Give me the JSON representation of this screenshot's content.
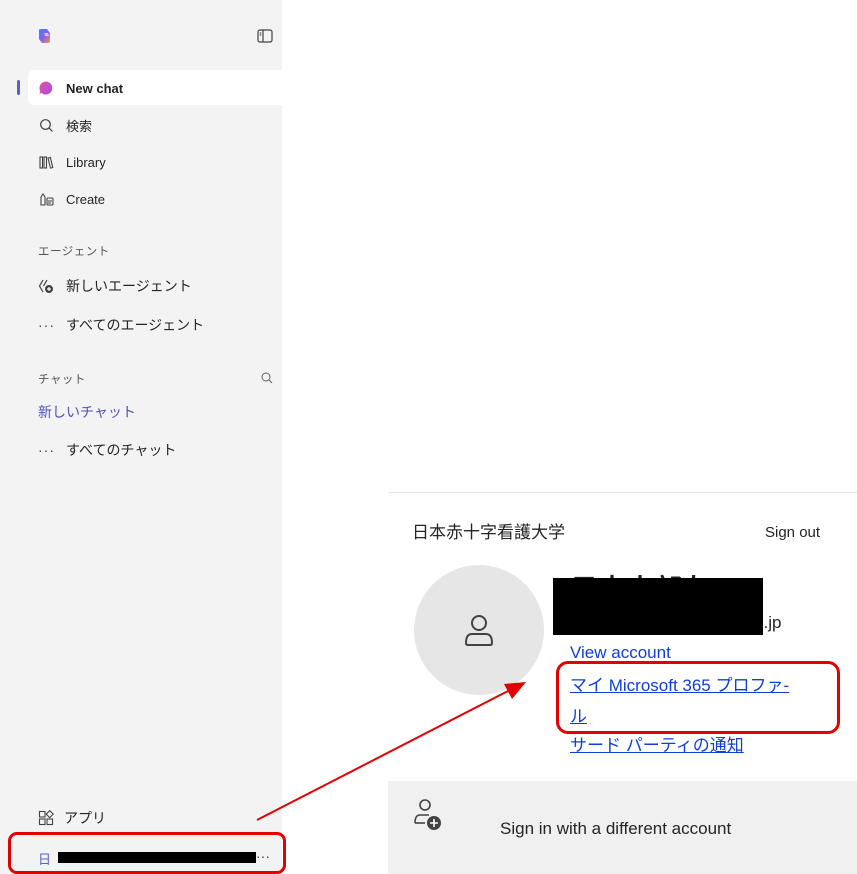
{
  "sidebar": {
    "new_chat": "New chat",
    "search": "検索",
    "library": "Library",
    "create": "Create",
    "agents_section": "エージェント",
    "new_agent": "新しいエージェント",
    "all_agents": "すべてのエージェント",
    "chats_section": "チャット",
    "recent_chat": "新しいチャット",
    "all_chats": "すべてのチャット",
    "apps": "アプリ",
    "account_initial": "日",
    "more": "···",
    "accent_color": "#5b5fc7"
  },
  "popup": {
    "organization": "日本赤十字看護大学",
    "sign_out": "Sign out",
    "user_name": "日本赤部丸",
    "email_suffix": "c.jp",
    "view_account": "View account",
    "m365_profile_line1": "マイ Microsoft 365 プロファ-",
    "m365_profile_line2": "ル",
    "third_party_notice": "サード パーティの通知",
    "sign_in_different": "Sign in with a different account",
    "link_color": "#0f3fd4"
  },
  "annotation": {
    "highlight_color": "#e20000"
  }
}
